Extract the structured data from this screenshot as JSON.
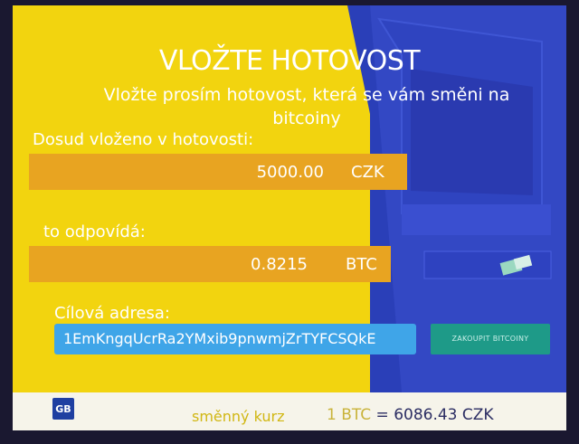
{
  "screen": {
    "title": "VLOŽTE HOTOVOST",
    "subtitle": "Vložte prosím hotovost, která se vám směni na bitcoiny",
    "inserted_label": "Dosud vloženo v hotovosti:",
    "inserted_amount": "5000.00",
    "inserted_currency": "CZK",
    "equivalent_label": "to odpovídá:",
    "equivalent_amount": "0.8215",
    "equivalent_currency": "BTC",
    "address_label": "Cílová adresa:",
    "address_value": "1EmKngqUcrRa2YMxib9pnwmjZrTYFCSQkE",
    "buy_button": "ZAKOUPIT BITCOINY"
  },
  "footer": {
    "logo_text": "GB",
    "rate_label": "směnný kurz",
    "rate_btc": "1 BTC",
    "rate_value": "= 6086.43 CZK"
  },
  "colors": {
    "background_yellow": "#f2d40f",
    "value_box": "#e8a421",
    "illustration_blue": "#2a3fb8",
    "address_box": "#3fa5e8",
    "buy_button": "#1e9a88"
  }
}
